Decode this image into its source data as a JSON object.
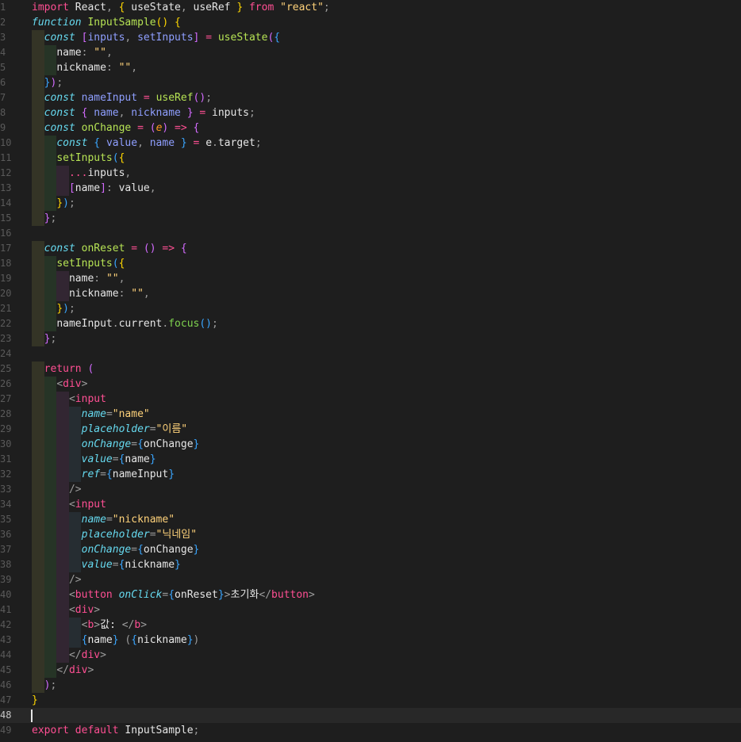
{
  "editor": {
    "language": "javascript",
    "current_line": 48,
    "lines": [
      [
        [
          "kw",
          "import"
        ],
        [
          "txt",
          " React"
        ],
        [
          "punc",
          ","
        ],
        [
          "txt",
          " "
        ],
        [
          "brk1",
          "{"
        ],
        [
          "txt",
          " useState"
        ],
        [
          "punc",
          ","
        ],
        [
          "txt",
          " useRef "
        ],
        [
          "brk1",
          "}"
        ],
        [
          "txt",
          " "
        ],
        [
          "kw",
          "from"
        ],
        [
          "txt",
          " "
        ],
        [
          "str",
          "\"react\""
        ],
        [
          "punc",
          ";"
        ]
      ],
      [
        [
          "decl",
          "function"
        ],
        [
          "txt",
          " "
        ],
        [
          "fn",
          "InputSample"
        ],
        [
          "brk1",
          "()"
        ],
        [
          "txt",
          " "
        ],
        [
          "brk1",
          "{"
        ]
      ],
      [
        [
          "txt",
          "  "
        ],
        [
          "decl",
          "const"
        ],
        [
          "txt",
          " "
        ],
        [
          "brk2",
          "["
        ],
        [
          "ident",
          "inputs"
        ],
        [
          "punc",
          ","
        ],
        [
          "txt",
          " "
        ],
        [
          "ident",
          "setInputs"
        ],
        [
          "brk2",
          "]"
        ],
        [
          "txt",
          " "
        ],
        [
          "kw",
          "="
        ],
        [
          "txt",
          " "
        ],
        [
          "fn",
          "useState"
        ],
        [
          "brk2",
          "("
        ],
        [
          "brk3",
          "{"
        ]
      ],
      [
        [
          "txt",
          "    "
        ],
        [
          "prop",
          "name"
        ],
        [
          "punc",
          ":"
        ],
        [
          "txt",
          " "
        ],
        [
          "str",
          "\"\""
        ],
        [
          "punc",
          ","
        ]
      ],
      [
        [
          "txt",
          "    "
        ],
        [
          "prop",
          "nickname"
        ],
        [
          "punc",
          ":"
        ],
        [
          "txt",
          " "
        ],
        [
          "str",
          "\"\""
        ],
        [
          "punc",
          ","
        ]
      ],
      [
        [
          "txt",
          "  "
        ],
        [
          "brk3",
          "}"
        ],
        [
          "brk2",
          ")"
        ],
        [
          "punc",
          ";"
        ]
      ],
      [
        [
          "txt",
          "  "
        ],
        [
          "decl",
          "const"
        ],
        [
          "txt",
          " "
        ],
        [
          "ident",
          "nameInput"
        ],
        [
          "txt",
          " "
        ],
        [
          "kw",
          "="
        ],
        [
          "txt",
          " "
        ],
        [
          "fn",
          "useRef"
        ],
        [
          "brk2",
          "()"
        ],
        [
          "punc",
          ";"
        ]
      ],
      [
        [
          "txt",
          "  "
        ],
        [
          "decl",
          "const"
        ],
        [
          "txt",
          " "
        ],
        [
          "brk2",
          "{"
        ],
        [
          "txt",
          " "
        ],
        [
          "ident",
          "name"
        ],
        [
          "punc",
          ","
        ],
        [
          "txt",
          " "
        ],
        [
          "ident",
          "nickname"
        ],
        [
          "txt",
          " "
        ],
        [
          "brk2",
          "}"
        ],
        [
          "txt",
          " "
        ],
        [
          "kw",
          "="
        ],
        [
          "txt",
          " "
        ],
        [
          "var",
          "inputs"
        ],
        [
          "punc",
          ";"
        ]
      ],
      [
        [
          "txt",
          "  "
        ],
        [
          "decl",
          "const"
        ],
        [
          "txt",
          " "
        ],
        [
          "fn",
          "onChange"
        ],
        [
          "txt",
          " "
        ],
        [
          "kw",
          "="
        ],
        [
          "txt",
          " "
        ],
        [
          "brk2",
          "("
        ],
        [
          "param",
          "e"
        ],
        [
          "brk2",
          ")"
        ],
        [
          "txt",
          " "
        ],
        [
          "kw",
          "=>"
        ],
        [
          "txt",
          " "
        ],
        [
          "brk2",
          "{"
        ]
      ],
      [
        [
          "txt",
          "    "
        ],
        [
          "decl",
          "const"
        ],
        [
          "txt",
          " "
        ],
        [
          "brk3",
          "{"
        ],
        [
          "txt",
          " "
        ],
        [
          "ident",
          "value"
        ],
        [
          "punc",
          ","
        ],
        [
          "txt",
          " "
        ],
        [
          "ident",
          "name"
        ],
        [
          "txt",
          " "
        ],
        [
          "brk3",
          "}"
        ],
        [
          "txt",
          " "
        ],
        [
          "kw",
          "="
        ],
        [
          "txt",
          " "
        ],
        [
          "var",
          "e"
        ],
        [
          "punc",
          "."
        ],
        [
          "var",
          "target"
        ],
        [
          "punc",
          ";"
        ]
      ],
      [
        [
          "txt",
          "    "
        ],
        [
          "fn",
          "setInputs"
        ],
        [
          "brk3",
          "("
        ],
        [
          "brk1",
          "{"
        ]
      ],
      [
        [
          "txt",
          "      "
        ],
        [
          "kw",
          "..."
        ],
        [
          "var",
          "inputs"
        ],
        [
          "punc",
          ","
        ]
      ],
      [
        [
          "txt",
          "      "
        ],
        [
          "brk2",
          "["
        ],
        [
          "var",
          "name"
        ],
        [
          "brk2",
          "]"
        ],
        [
          "punc",
          ":"
        ],
        [
          "txt",
          " "
        ],
        [
          "var",
          "value"
        ],
        [
          "punc",
          ","
        ]
      ],
      [
        [
          "txt",
          "    "
        ],
        [
          "brk1",
          "}"
        ],
        [
          "brk3",
          ")"
        ],
        [
          "punc",
          ";"
        ]
      ],
      [
        [
          "txt",
          "  "
        ],
        [
          "brk2",
          "}"
        ],
        [
          "punc",
          ";"
        ]
      ],
      [
        [
          "txt",
          ""
        ]
      ],
      [
        [
          "txt",
          "  "
        ],
        [
          "decl",
          "const"
        ],
        [
          "txt",
          " "
        ],
        [
          "fn",
          "onReset"
        ],
        [
          "txt",
          " "
        ],
        [
          "kw",
          "="
        ],
        [
          "txt",
          " "
        ],
        [
          "brk2",
          "()"
        ],
        [
          "txt",
          " "
        ],
        [
          "kw",
          "=>"
        ],
        [
          "txt",
          " "
        ],
        [
          "brk2",
          "{"
        ]
      ],
      [
        [
          "txt",
          "    "
        ],
        [
          "fn",
          "setInputs"
        ],
        [
          "brk3",
          "("
        ],
        [
          "brk1",
          "{"
        ]
      ],
      [
        [
          "txt",
          "      "
        ],
        [
          "prop",
          "name"
        ],
        [
          "punc",
          ":"
        ],
        [
          "txt",
          " "
        ],
        [
          "str",
          "\"\""
        ],
        [
          "punc",
          ","
        ]
      ],
      [
        [
          "txt",
          "      "
        ],
        [
          "prop",
          "nickname"
        ],
        [
          "punc",
          ":"
        ],
        [
          "txt",
          " "
        ],
        [
          "str",
          "\"\""
        ],
        [
          "punc",
          ","
        ]
      ],
      [
        [
          "txt",
          "    "
        ],
        [
          "brk1",
          "}"
        ],
        [
          "brk3",
          ")"
        ],
        [
          "punc",
          ";"
        ]
      ],
      [
        [
          "txt",
          "    "
        ],
        [
          "var",
          "nameInput"
        ],
        [
          "punc",
          "."
        ],
        [
          "var",
          "current"
        ],
        [
          "punc",
          "."
        ],
        [
          "mth",
          "focus"
        ],
        [
          "brk3",
          "()"
        ],
        [
          "punc",
          ";"
        ]
      ],
      [
        [
          "txt",
          "  "
        ],
        [
          "brk2",
          "}"
        ],
        [
          "punc",
          ";"
        ]
      ],
      [
        [
          "txt",
          ""
        ]
      ],
      [
        [
          "txt",
          "  "
        ],
        [
          "kw",
          "return"
        ],
        [
          "txt",
          " "
        ],
        [
          "brk2",
          "("
        ]
      ],
      [
        [
          "txt",
          "    "
        ],
        [
          "punc",
          "<"
        ],
        [
          "tag",
          "div"
        ],
        [
          "punc",
          ">"
        ]
      ],
      [
        [
          "txt",
          "      "
        ],
        [
          "punc",
          "<"
        ],
        [
          "tag",
          "input"
        ]
      ],
      [
        [
          "txt",
          "        "
        ],
        [
          "attr",
          "name"
        ],
        [
          "punc",
          "="
        ],
        [
          "str",
          "\"name\""
        ]
      ],
      [
        [
          "txt",
          "        "
        ],
        [
          "attr",
          "placeholder"
        ],
        [
          "punc",
          "="
        ],
        [
          "str",
          "\"이름\""
        ]
      ],
      [
        [
          "txt",
          "        "
        ],
        [
          "attr",
          "onChange"
        ],
        [
          "punc",
          "="
        ],
        [
          "brk3",
          "{"
        ],
        [
          "var",
          "onChange"
        ],
        [
          "brk3",
          "}"
        ]
      ],
      [
        [
          "txt",
          "        "
        ],
        [
          "attr",
          "value"
        ],
        [
          "punc",
          "="
        ],
        [
          "brk3",
          "{"
        ],
        [
          "var",
          "name"
        ],
        [
          "brk3",
          "}"
        ]
      ],
      [
        [
          "txt",
          "        "
        ],
        [
          "attr",
          "ref"
        ],
        [
          "punc",
          "="
        ],
        [
          "brk3",
          "{"
        ],
        [
          "var",
          "nameInput"
        ],
        [
          "brk3",
          "}"
        ]
      ],
      [
        [
          "txt",
          "      "
        ],
        [
          "punc",
          "/>"
        ]
      ],
      [
        [
          "txt",
          "      "
        ],
        [
          "punc",
          "<"
        ],
        [
          "tag",
          "input"
        ]
      ],
      [
        [
          "txt",
          "        "
        ],
        [
          "attr",
          "name"
        ],
        [
          "punc",
          "="
        ],
        [
          "str",
          "\"nickname\""
        ]
      ],
      [
        [
          "txt",
          "        "
        ],
        [
          "attr",
          "placeholder"
        ],
        [
          "punc",
          "="
        ],
        [
          "str",
          "\"닉네임\""
        ]
      ],
      [
        [
          "txt",
          "        "
        ],
        [
          "attr",
          "onChange"
        ],
        [
          "punc",
          "="
        ],
        [
          "brk3",
          "{"
        ],
        [
          "var",
          "onChange"
        ],
        [
          "brk3",
          "}"
        ]
      ],
      [
        [
          "txt",
          "        "
        ],
        [
          "attr",
          "value"
        ],
        [
          "punc",
          "="
        ],
        [
          "brk3",
          "{"
        ],
        [
          "var",
          "nickname"
        ],
        [
          "brk3",
          "}"
        ]
      ],
      [
        [
          "txt",
          "      "
        ],
        [
          "punc",
          "/>"
        ]
      ],
      [
        [
          "txt",
          "      "
        ],
        [
          "punc",
          "<"
        ],
        [
          "tag",
          "button"
        ],
        [
          "txt",
          " "
        ],
        [
          "attr",
          "onClick"
        ],
        [
          "punc",
          "="
        ],
        [
          "brk3",
          "{"
        ],
        [
          "var",
          "onReset"
        ],
        [
          "brk3",
          "}"
        ],
        [
          "punc",
          ">"
        ],
        [
          "txt",
          "초기화"
        ],
        [
          "punc",
          "</"
        ],
        [
          "tag",
          "button"
        ],
        [
          "punc",
          ">"
        ]
      ],
      [
        [
          "txt",
          "      "
        ],
        [
          "punc",
          "<"
        ],
        [
          "tag",
          "div"
        ],
        [
          "punc",
          ">"
        ]
      ],
      [
        [
          "txt",
          "        "
        ],
        [
          "punc",
          "<"
        ],
        [
          "tag",
          "b"
        ],
        [
          "punc",
          ">"
        ],
        [
          "txt",
          "값: "
        ],
        [
          "punc",
          "</"
        ],
        [
          "tag",
          "b"
        ],
        [
          "punc",
          ">"
        ]
      ],
      [
        [
          "txt",
          "        "
        ],
        [
          "brk3",
          "{"
        ],
        [
          "var",
          "name"
        ],
        [
          "brk3",
          "}"
        ],
        [
          "txt",
          " "
        ],
        [
          "punc",
          "("
        ],
        [
          "brk3",
          "{"
        ],
        [
          "var",
          "nickname"
        ],
        [
          "brk3",
          "}"
        ],
        [
          "punc",
          ")"
        ]
      ],
      [
        [
          "txt",
          "      "
        ],
        [
          "punc",
          "</"
        ],
        [
          "tag",
          "div"
        ],
        [
          "punc",
          ">"
        ]
      ],
      [
        [
          "txt",
          "    "
        ],
        [
          "punc",
          "</"
        ],
        [
          "tag",
          "div"
        ],
        [
          "punc",
          ">"
        ]
      ],
      [
        [
          "txt",
          "  "
        ],
        [
          "brk2",
          ")"
        ],
        [
          "punc",
          ";"
        ]
      ],
      [
        [
          "brk1",
          "}"
        ]
      ],
      [
        [
          "txt",
          ""
        ]
      ],
      [
        [
          "kw",
          "export"
        ],
        [
          "txt",
          " "
        ],
        [
          "kw",
          "default"
        ],
        [
          "txt",
          " "
        ],
        [
          "var",
          "InputSample"
        ],
        [
          "punc",
          ";"
        ]
      ]
    ]
  }
}
